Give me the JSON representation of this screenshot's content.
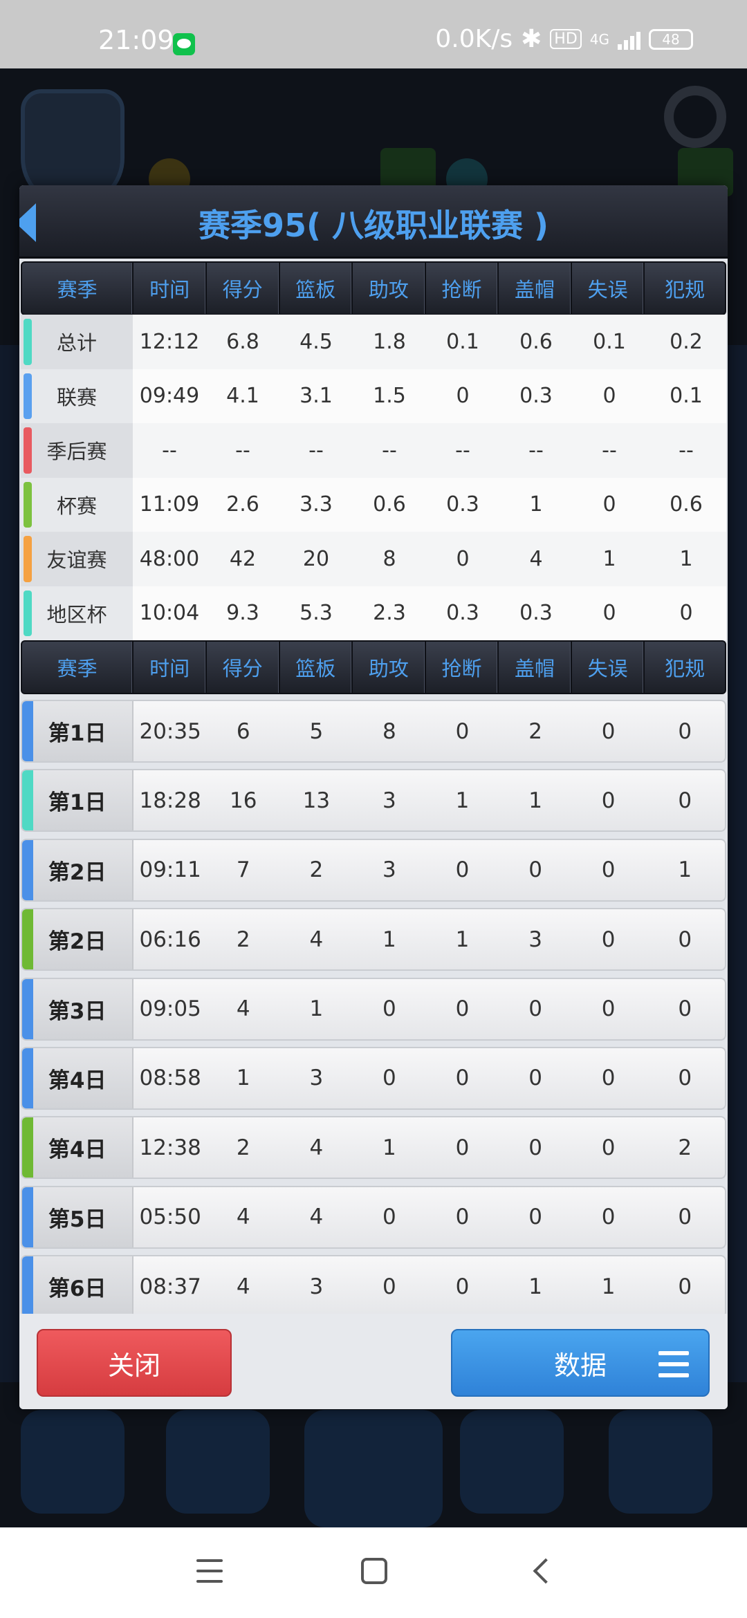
{
  "status_bar": {
    "time": "21:09",
    "net_speed": "0.0K/s",
    "hd_label": "HD",
    "network_label": "4G",
    "battery": "48",
    "icons": [
      "wechat-icon",
      "bluetooth-icon",
      "signal-icon",
      "battery-icon"
    ]
  },
  "dialog": {
    "title": "赛季95( 八级职业联赛 )",
    "columns": [
      "赛季",
      "时间",
      "得分",
      "篮板",
      "助攻",
      "抢断",
      "盖帽",
      "失误",
      "犯规"
    ],
    "summary_rows": [
      {
        "label": "总计",
        "color": "#4fd9c4",
        "values": [
          "12:12",
          "6.8",
          "4.5",
          "1.8",
          "0.1",
          "0.6",
          "0.1",
          "0.2"
        ]
      },
      {
        "label": "联赛",
        "color": "#5aa0ef",
        "values": [
          "09:49",
          "4.1",
          "3.1",
          "1.5",
          "0",
          "0.3",
          "0",
          "0.1"
        ]
      },
      {
        "label": "季后赛",
        "color": "#e85a60",
        "values": [
          "--",
          "--",
          "--",
          "--",
          "--",
          "--",
          "--",
          "--"
        ]
      },
      {
        "label": "杯赛",
        "color": "#7dc240",
        "values": [
          "11:09",
          "2.6",
          "3.3",
          "0.6",
          "0.3",
          "1",
          "0",
          "0.6"
        ]
      },
      {
        "label": "友谊赛",
        "color": "#f5a142",
        "values": [
          "48:00",
          "42",
          "20",
          "8",
          "0",
          "4",
          "1",
          "1"
        ]
      },
      {
        "label": "地区杯",
        "color": "#4fd9c4",
        "values": [
          "10:04",
          "9.3",
          "5.3",
          "2.3",
          "0.3",
          "0.3",
          "0",
          "0"
        ]
      }
    ],
    "daily_rows": [
      {
        "label": "第1日",
        "color": "#4a90e8",
        "values": [
          "20:35",
          "6",
          "5",
          "8",
          "0",
          "2",
          "0",
          "0"
        ]
      },
      {
        "label": "第1日",
        "color": "#4fd9c4",
        "values": [
          "18:28",
          "16",
          "13",
          "3",
          "1",
          "1",
          "0",
          "0"
        ]
      },
      {
        "label": "第2日",
        "color": "#4a90e8",
        "values": [
          "09:11",
          "7",
          "2",
          "3",
          "0",
          "0",
          "0",
          "1"
        ]
      },
      {
        "label": "第2日",
        "color": "#6fb934",
        "values": [
          "06:16",
          "2",
          "4",
          "1",
          "1",
          "3",
          "0",
          "0"
        ]
      },
      {
        "label": "第3日",
        "color": "#4a90e8",
        "values": [
          "09:05",
          "4",
          "1",
          "0",
          "0",
          "0",
          "0",
          "0"
        ]
      },
      {
        "label": "第4日",
        "color": "#4a90e8",
        "values": [
          "08:58",
          "1",
          "3",
          "0",
          "0",
          "0",
          "0",
          "0"
        ]
      },
      {
        "label": "第4日",
        "color": "#6fb934",
        "values": [
          "12:38",
          "2",
          "4",
          "1",
          "0",
          "0",
          "0",
          "2"
        ]
      },
      {
        "label": "第5日",
        "color": "#4a90e8",
        "values": [
          "05:50",
          "4",
          "4",
          "0",
          "0",
          "0",
          "0",
          "0"
        ]
      },
      {
        "label": "第6日",
        "color": "#4a90e8",
        "values": [
          "08:37",
          "4",
          "3",
          "0",
          "0",
          "1",
          "1",
          "0"
        ]
      }
    ],
    "close_label": "关闭",
    "data_label": "数据"
  },
  "nav_bar": {
    "icons": [
      "menu-icon",
      "home-icon",
      "back-icon"
    ]
  }
}
